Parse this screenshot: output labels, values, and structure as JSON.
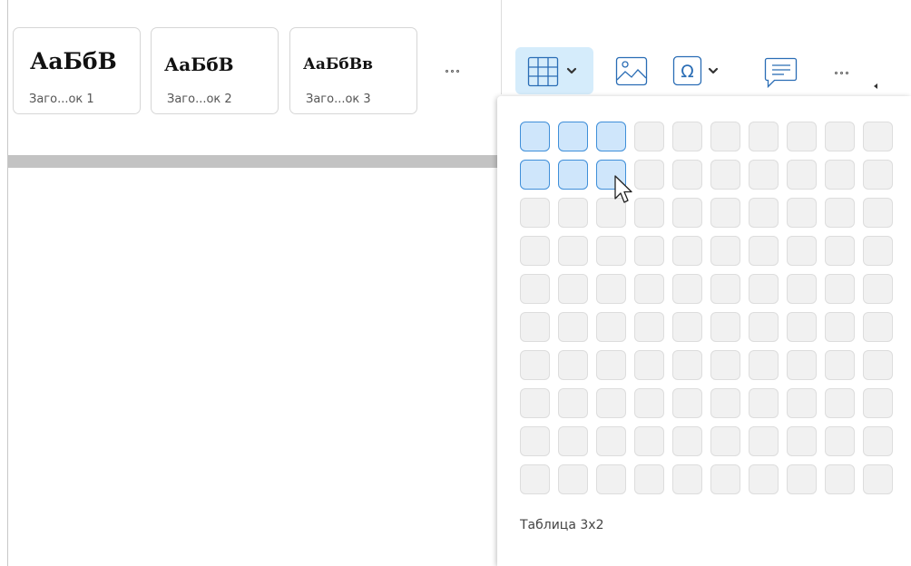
{
  "style_gallery": {
    "cards": [
      {
        "sample": "АаБбВ",
        "caption": "Заго...ок 1"
      },
      {
        "sample": "АаБбВ",
        "caption": "Заго...ок 2"
      },
      {
        "sample": "АаБбВв",
        "caption": "Заго...ок 3"
      }
    ],
    "more_icon": "ellipsis-icon"
  },
  "toolbar": {
    "buttons": [
      {
        "name": "table",
        "icon": "table-icon",
        "has_dropdown": true,
        "active": true
      },
      {
        "name": "image",
        "icon": "image-icon",
        "has_dropdown": false
      },
      {
        "name": "special-symbol",
        "icon": "omega-icon",
        "has_dropdown": true
      },
      {
        "name": "comment",
        "icon": "comment-icon",
        "has_dropdown": false
      }
    ]
  },
  "table_picker": {
    "columns": 10,
    "rows": 10,
    "selected_columns": 3,
    "selected_rows": 2,
    "label": "Таблица 3x2"
  },
  "colors": {
    "selection_fill": "#cfe6fb",
    "selection_border": "#3f8fd9",
    "active_button": "#d5ecfb"
  }
}
